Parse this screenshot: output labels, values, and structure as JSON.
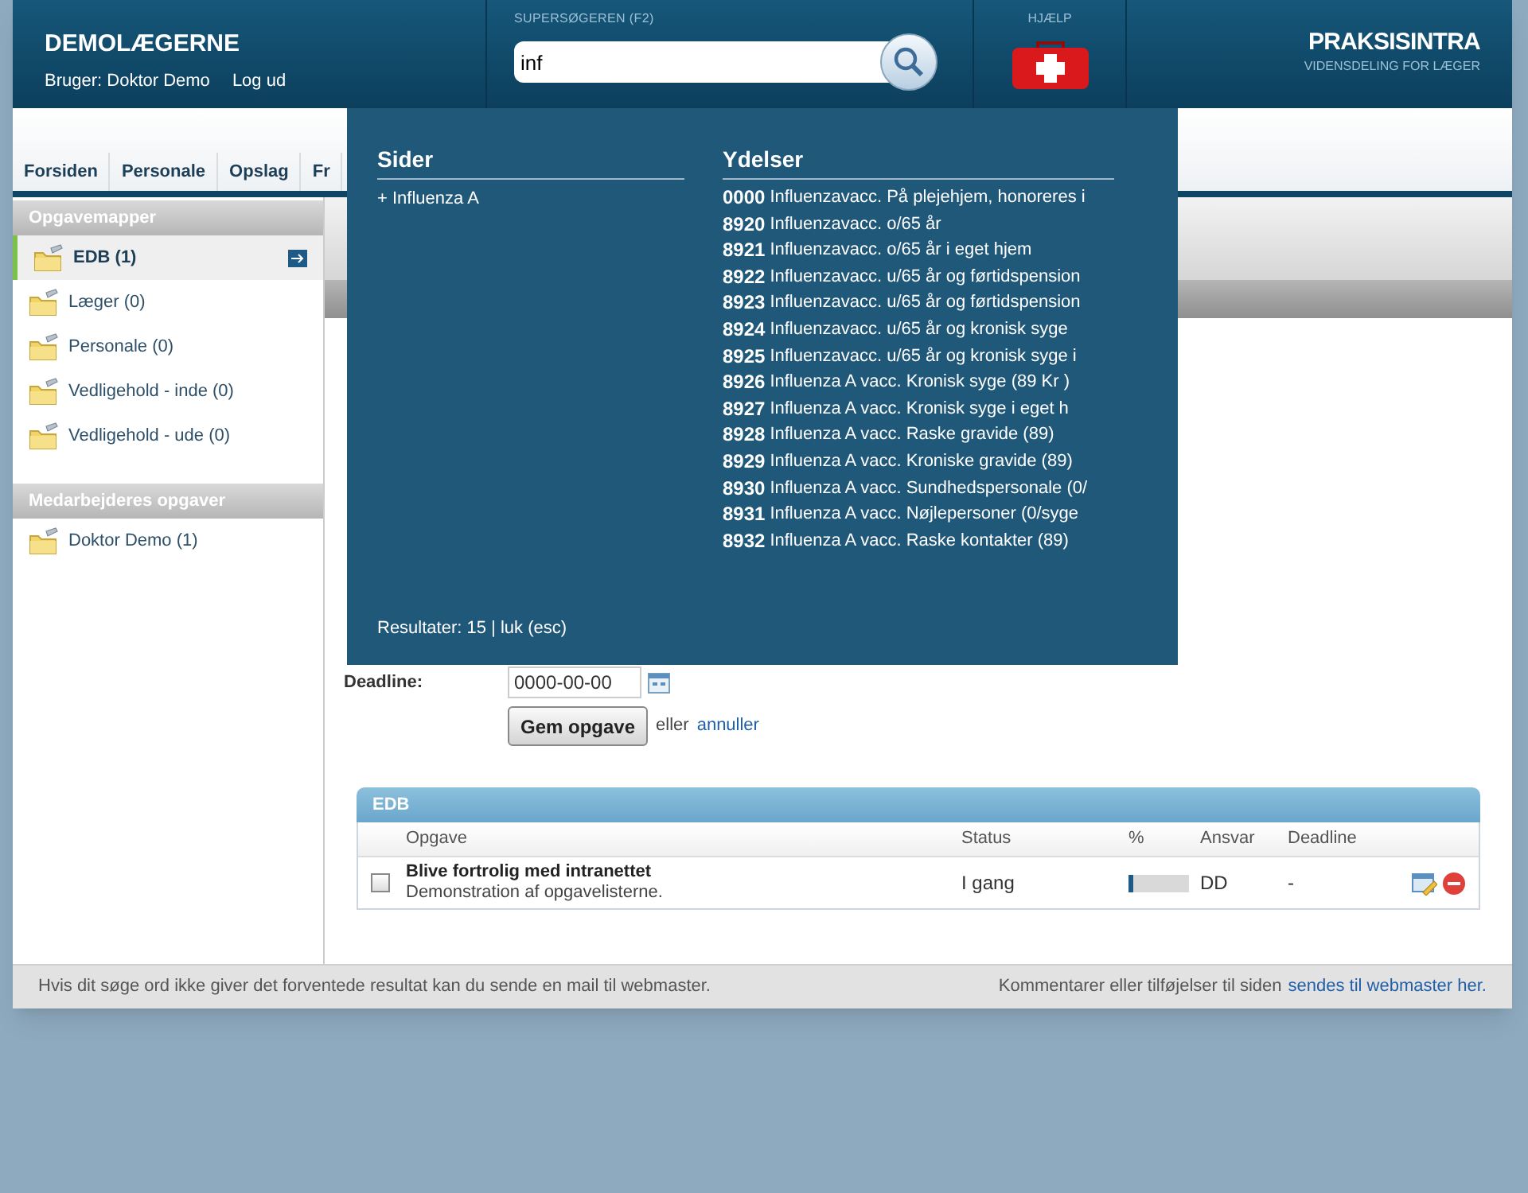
{
  "header": {
    "title": "DEMOLÆGERNE",
    "user_label": "Bruger: Doktor Demo",
    "logout": "Log ud",
    "search": {
      "label": "SUPERSØGEREN (F2)",
      "value": "inf"
    },
    "help_label": "HJÆLP",
    "logo": {
      "name": "PRAKSISINTRA",
      "tagline": "VIDENSDELING FOR LÆGER"
    }
  },
  "nav": {
    "tabs": [
      {
        "label": "Forsiden"
      },
      {
        "label": "Personale"
      },
      {
        "label": "Opslag"
      },
      {
        "label": "Fr"
      }
    ]
  },
  "sidebar": {
    "sections": [
      {
        "title": "Opgavemapper",
        "items": [
          {
            "label": "EDB (1)",
            "selected": true
          },
          {
            "label": "Læger (0)",
            "selected": false
          },
          {
            "label": "Personale (0)",
            "selected": false
          },
          {
            "label": "Vedligehold - inde (0)",
            "selected": false
          },
          {
            "label": "Vedligehold - ude (0)",
            "selected": false
          }
        ]
      },
      {
        "title": "Medarbejderes opgaver",
        "items": [
          {
            "label": "Doktor Demo (1)",
            "selected": false
          }
        ]
      }
    ]
  },
  "form": {
    "deadline_label": "Deadline:",
    "deadline_value": "0000-00-00",
    "save_button": "Gem opgave",
    "or_text": "eller",
    "cancel_link": "annuller"
  },
  "task_panel": {
    "title": "EDB",
    "columns": [
      "Opgave",
      "Status",
      "%",
      "Ansvar",
      "Deadline"
    ],
    "rows": [
      {
        "checked": false,
        "title": "Blive fortrolig med intranettet",
        "description": "Demonstration af opgavelisterne.",
        "status": "I gang",
        "level": 0.08,
        "responsible": "DD",
        "deadline": "-"
      }
    ]
  },
  "footer": {
    "left_text": "Hvis dit søge ord ikke giver det forventede resultat kan du sende en mail til webmaster.",
    "right_text": "Kommentarer eller tilføjelser til siden",
    "right_link": "sendes til webmaster her."
  },
  "search_results": {
    "pages": {
      "title": "Sider",
      "items": [
        "+ Influenza A"
      ]
    },
    "services": {
      "title": "Ydelser",
      "items": [
        {
          "code": "0000",
          "text": "Influenzavacc. På plejehjem, honoreres i"
        },
        {
          "code": "8920",
          "text": "Influenzavacc. o/65 år"
        },
        {
          "code": "8921",
          "text": "Influenzavacc. o/65 år i eget hjem"
        },
        {
          "code": "8922",
          "text": "Influenzavacc. u/65 år og førtidspension"
        },
        {
          "code": "8923",
          "text": "Influenzavacc. u/65 år og førtidspension"
        },
        {
          "code": "8924",
          "text": "Influenzavacc. u/65 år og kronisk syge"
        },
        {
          "code": "8925",
          "text": "Influenzavacc. u/65 år og kronisk syge i"
        },
        {
          "code": "8926",
          "text": "Influenza A vacc. Kronisk syge (89 Kr )"
        },
        {
          "code": "8927",
          "text": "Influenza A vacc. Kronisk syge i eget h"
        },
        {
          "code": "8928",
          "text": "Influenza A vacc. Raske gravide (89)"
        },
        {
          "code": "8929",
          "text": "Influenza A vacc. Kroniske gravide (89)"
        },
        {
          "code": "8930",
          "text": "Influenza A vacc. Sundhedspersonale (0/"
        },
        {
          "code": "8931",
          "text": "Influenza A vacc. Nøjlepersoner (0/syge"
        },
        {
          "code": "8932",
          "text": "Influenza A vacc. Raske kontakter (89)"
        }
      ]
    },
    "summary": "Resultater: 15 | luk (esc)"
  }
}
